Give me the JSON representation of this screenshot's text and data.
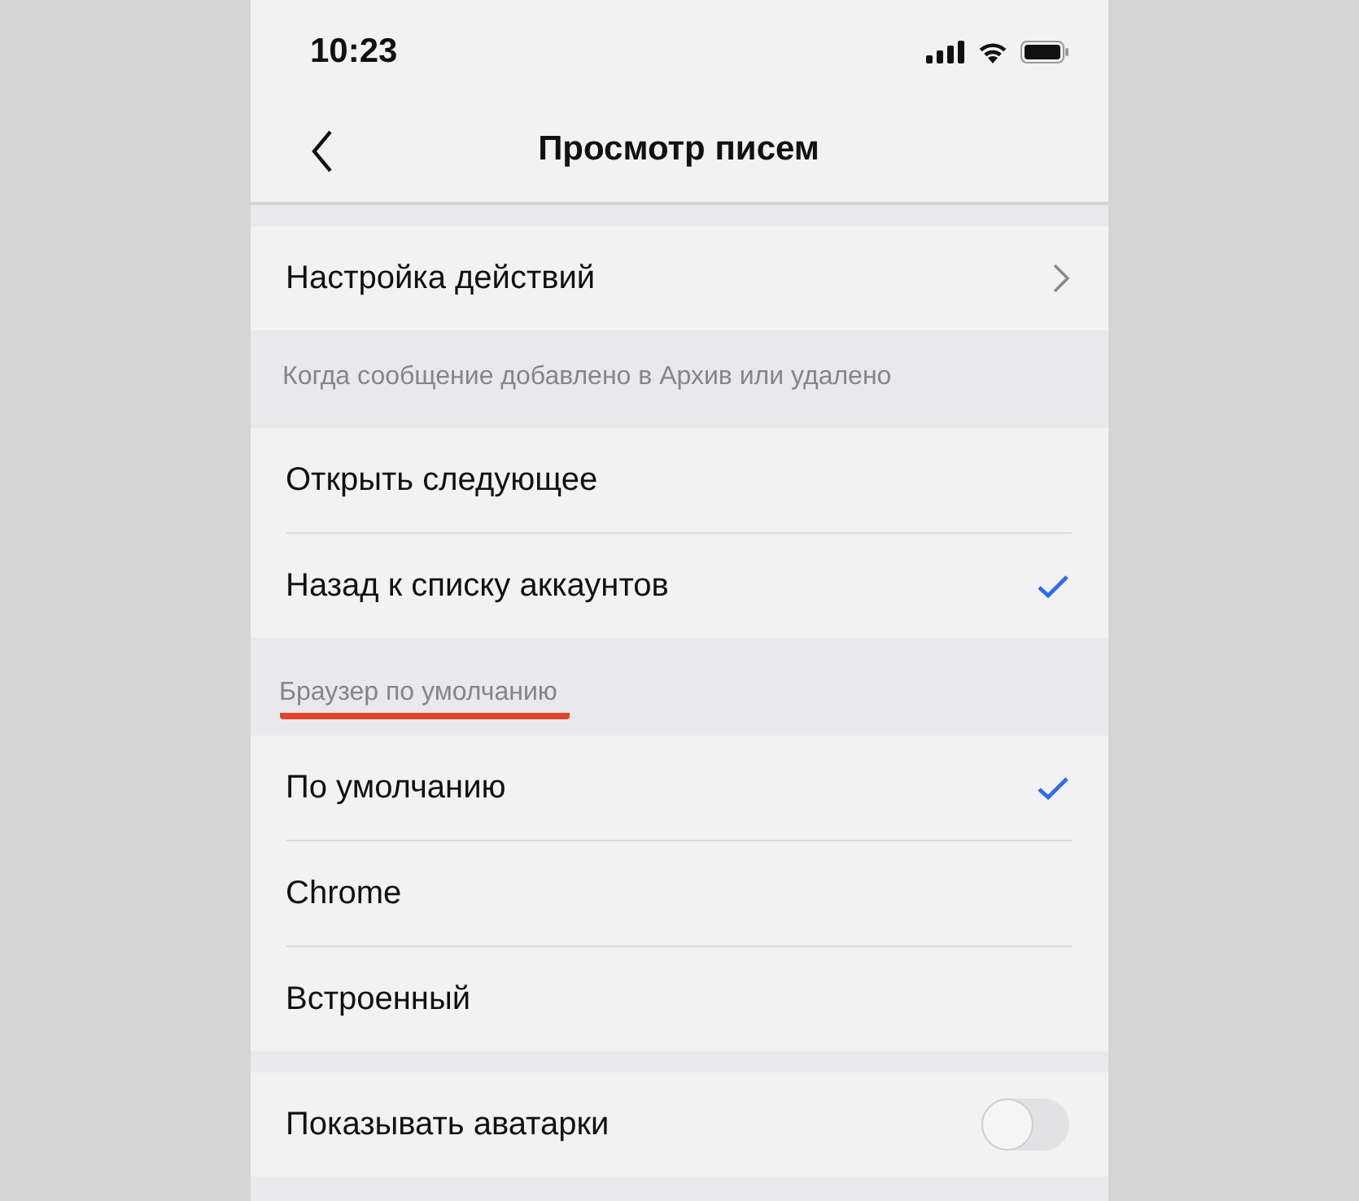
{
  "status_bar": {
    "time": "10:23"
  },
  "nav": {
    "title": "Просмотр писем"
  },
  "sections": [
    {
      "rows": [
        {
          "kind": "link",
          "label": "Настройка действий"
        }
      ]
    },
    {
      "header": {
        "text": "Когда сообщение добавлено в Архив или удалено",
        "underlined": false
      },
      "rows": [
        {
          "kind": "choice",
          "label": "Открыть следующее",
          "selected": false
        },
        {
          "kind": "choice",
          "label": "Назад к списку аккаунтов",
          "selected": true
        }
      ]
    },
    {
      "header": {
        "text": "Браузер по умолчанию",
        "underlined": true
      },
      "rows": [
        {
          "kind": "choice",
          "label": "По умолчанию",
          "selected": true
        },
        {
          "kind": "choice",
          "label": "Chrome",
          "selected": false
        },
        {
          "kind": "choice",
          "label": "Встроенный",
          "selected": false
        }
      ]
    },
    {
      "rows": [
        {
          "kind": "toggle",
          "label": "Показывать аватарки",
          "on": false
        }
      ]
    }
  ]
}
